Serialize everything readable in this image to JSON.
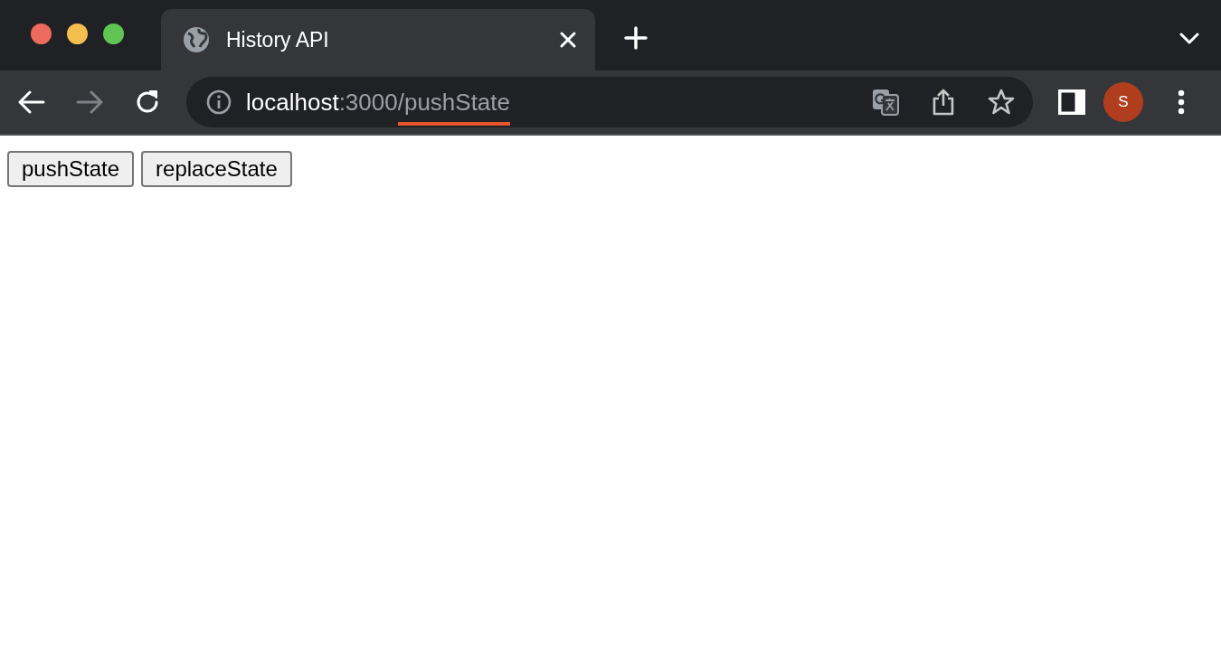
{
  "tab": {
    "title": "History API",
    "selected": true
  },
  "address_bar": {
    "host": "localhost",
    "port": ":3000",
    "path": "/pushState"
  },
  "profile": {
    "initial": "S"
  },
  "navigation": {
    "forward_disabled": true
  },
  "page": {
    "buttons": [
      "pushState",
      "replaceState"
    ]
  }
}
